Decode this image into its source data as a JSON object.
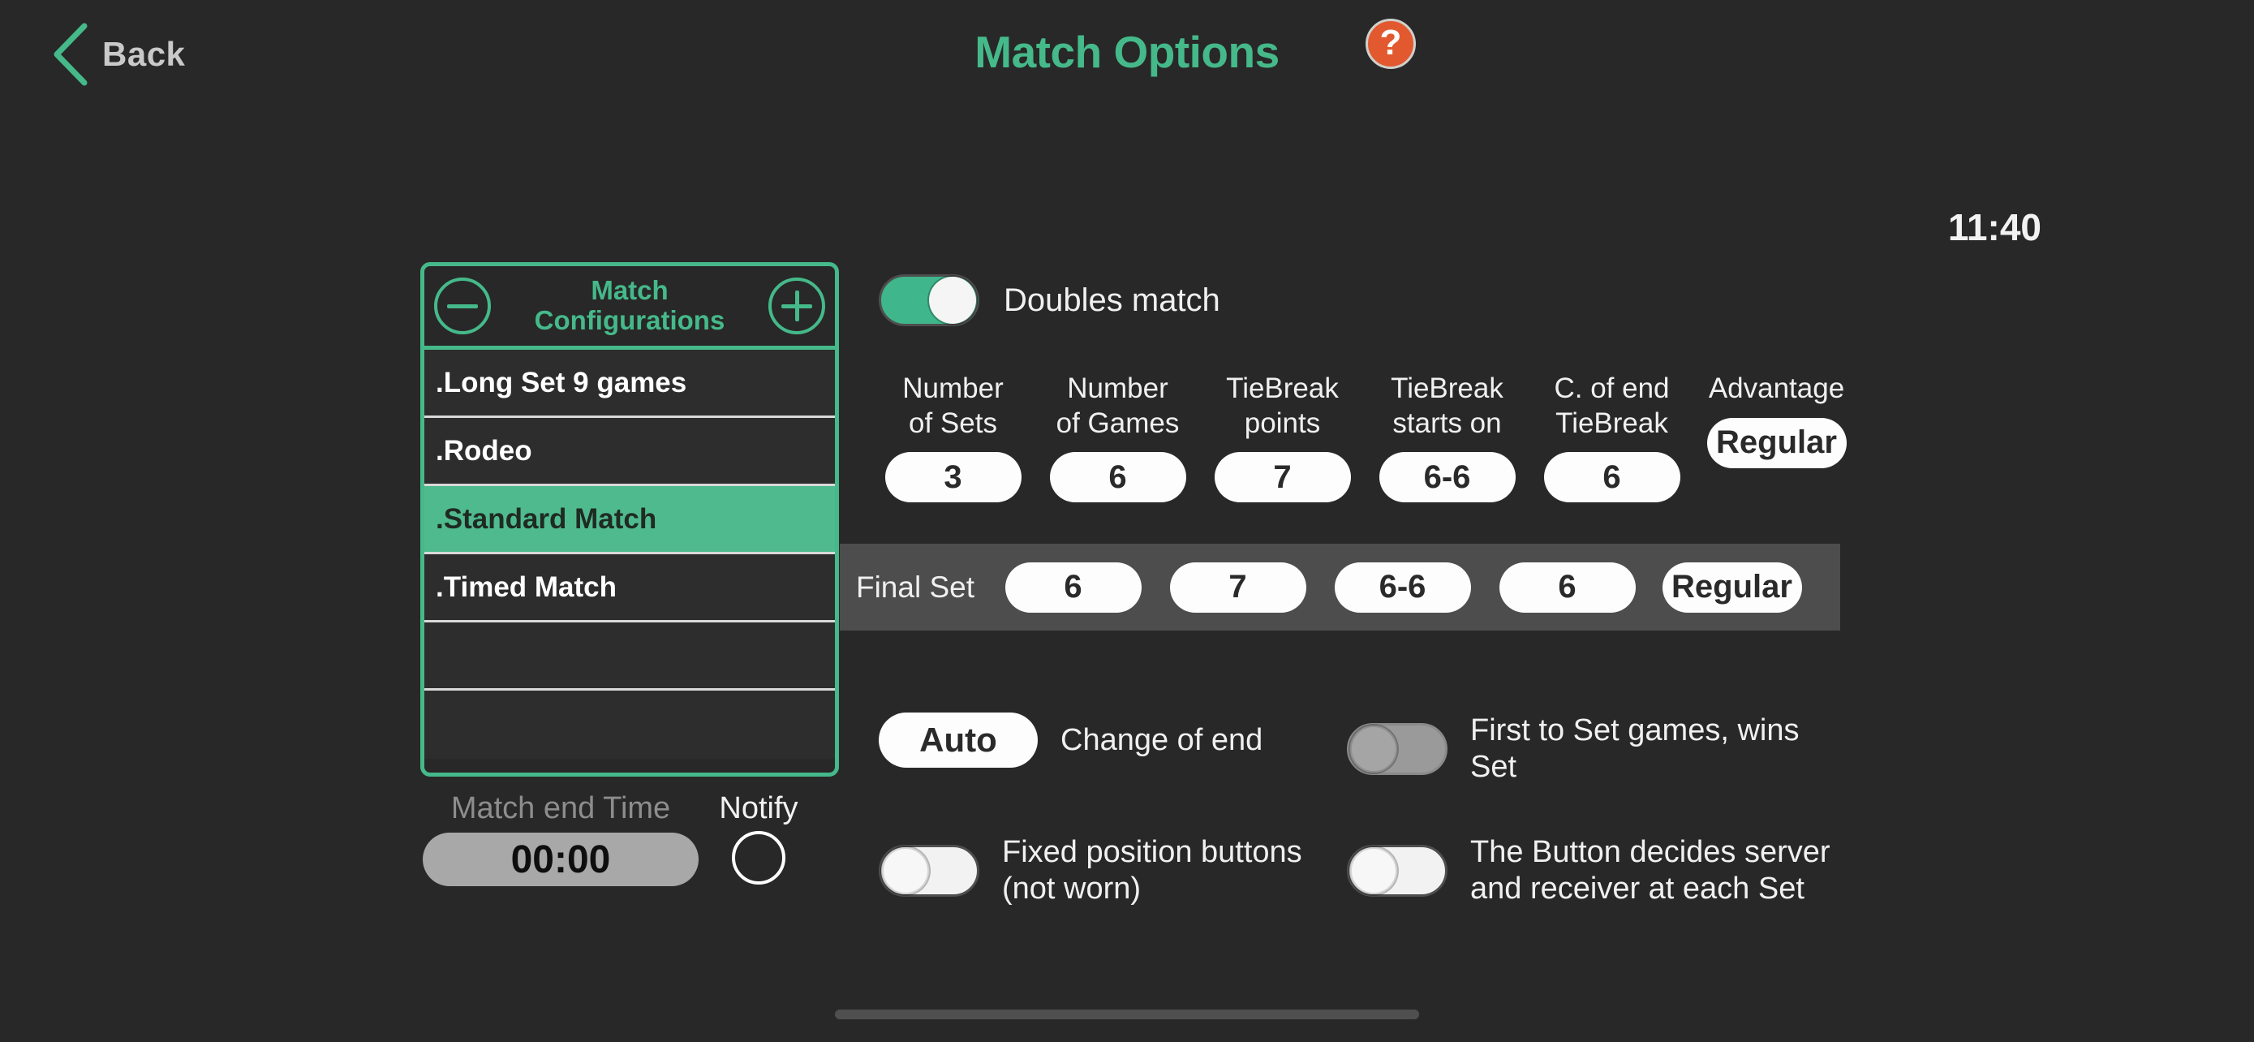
{
  "header": {
    "back_label": "Back",
    "back_icon": "chevron-left-icon",
    "title": "Match Options",
    "help_icon": "question-mark-icon",
    "help_label": "?",
    "clock": "11:40"
  },
  "colors": {
    "accent_green": "#45b98a",
    "selected_green": "#4fba8e",
    "help_orange": "#e2592f",
    "background": "#282828",
    "band_gray": "#4d4d4d"
  },
  "config_panel": {
    "title": "Match\nConfigurations",
    "minus_icon": "minus-circle-icon",
    "plus_icon": "plus-circle-icon",
    "items": [
      {
        "label": ".Long Set 9 games",
        "selected": false
      },
      {
        "label": ".Rodeo",
        "selected": false
      },
      {
        "label": ".Standard Match",
        "selected": true
      },
      {
        "label": ".Timed Match",
        "selected": false
      },
      {
        "label": "",
        "selected": false
      },
      {
        "label": "",
        "selected": false
      }
    ]
  },
  "match_end_time": {
    "label": "Match end Time",
    "value": "00:00",
    "notify_label": "Notify",
    "notify_checked": false
  },
  "doubles": {
    "label": "Doubles match",
    "state": "on"
  },
  "settings_grid": {
    "columns": [
      {
        "title": "Number\nof Sets",
        "value": "3"
      },
      {
        "title": "Number\nof Games",
        "value": "6"
      },
      {
        "title": "TieBreak\npoints",
        "value": "7"
      },
      {
        "title": "TieBreak\nstarts on",
        "value": "6-6"
      },
      {
        "title": "C. of end\nTieBreak",
        "value": "6"
      },
      {
        "title": "Advantage",
        "value": "Regular"
      }
    ]
  },
  "final_set": {
    "label": "Final Set",
    "values": [
      "6",
      "7",
      "6-6",
      "6",
      "Regular"
    ]
  },
  "options": [
    {
      "control": "auto-pill",
      "control_label": "Auto",
      "label": "Change of end",
      "state": "value"
    },
    {
      "control": "toggle",
      "control_label": "",
      "label": "First to Set games, wins\nSet",
      "state": "disabled"
    },
    {
      "control": "toggle",
      "control_label": "",
      "label": "Fixed position\nbuttons (not worn)",
      "state": "off"
    },
    {
      "control": "toggle",
      "control_label": "",
      "label": "The Button decides server\nand receiver at each Set",
      "state": "off"
    }
  ]
}
